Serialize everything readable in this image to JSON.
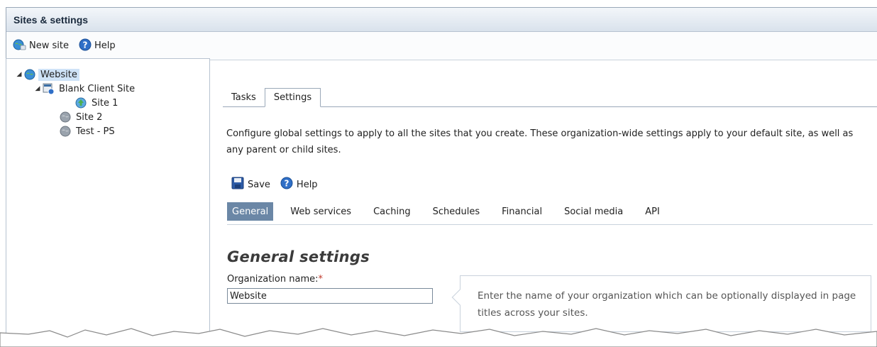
{
  "window": {
    "title": "Sites & settings"
  },
  "toolbar": {
    "new_site": "New site",
    "help": "Help"
  },
  "tree": {
    "root": "Website",
    "child": "Blank Client Site",
    "grandchild": "Site 1",
    "items": [
      "Site 2",
      "Test - PS"
    ]
  },
  "tabs": [
    "Tasks",
    "Settings"
  ],
  "description": "Configure global settings to apply to all the sites that you create. These organization-wide settings apply to your default site, as well as any parent or child sites.",
  "actions": {
    "save": "Save",
    "help": "Help"
  },
  "subtabs": [
    "General",
    "Web services",
    "Caching",
    "Schedules",
    "Financial",
    "Social media",
    "API"
  ],
  "section_title": "General settings",
  "org_field": {
    "label": "Organization name:",
    "required_mark": "*",
    "value": "Website",
    "hint": "Enter the name of your organization which can be optionally displayed in page titles across your sites."
  },
  "colors": {
    "active_subtab": "#6b87a6",
    "selected_node": "#cfe3f7",
    "required": "#c0392b"
  },
  "icons": {
    "new_site": "globe-add-icon",
    "help": "help-circle-icon",
    "save": "floppy-disk-icon"
  }
}
